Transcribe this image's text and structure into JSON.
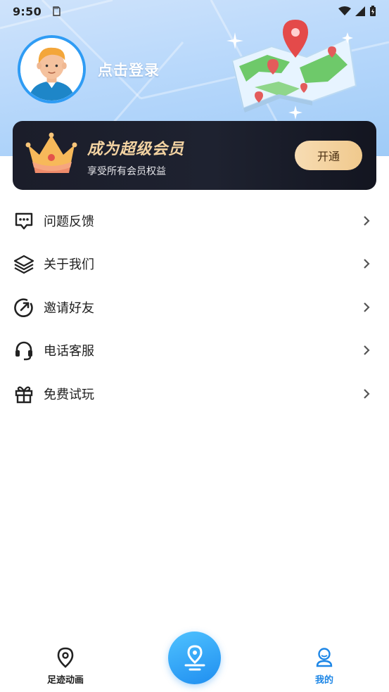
{
  "status_bar": {
    "time": "9:50"
  },
  "profile": {
    "login_text": "点击登录"
  },
  "vip": {
    "title": "成为超级会员",
    "subtitle": "享受所有会员权益",
    "button_label": "开通"
  },
  "menu": {
    "items": [
      {
        "label": "问题反馈",
        "icon": "feedback-chat-icon"
      },
      {
        "label": "关于我们",
        "icon": "layers-icon"
      },
      {
        "label": "邀请好友",
        "icon": "invite-refresh-icon"
      },
      {
        "label": "电话客服",
        "icon": "headset-icon"
      },
      {
        "label": "免费试玩",
        "icon": "gift-icon"
      }
    ]
  },
  "bottom_nav": {
    "left_label": "足迹动画",
    "right_label": "我的",
    "active_color": "#1d86e6"
  },
  "colors": {
    "accent": "#2f9cf4",
    "vip_gold": "#f3d3a2",
    "card_dark": "#1b1d2a"
  }
}
